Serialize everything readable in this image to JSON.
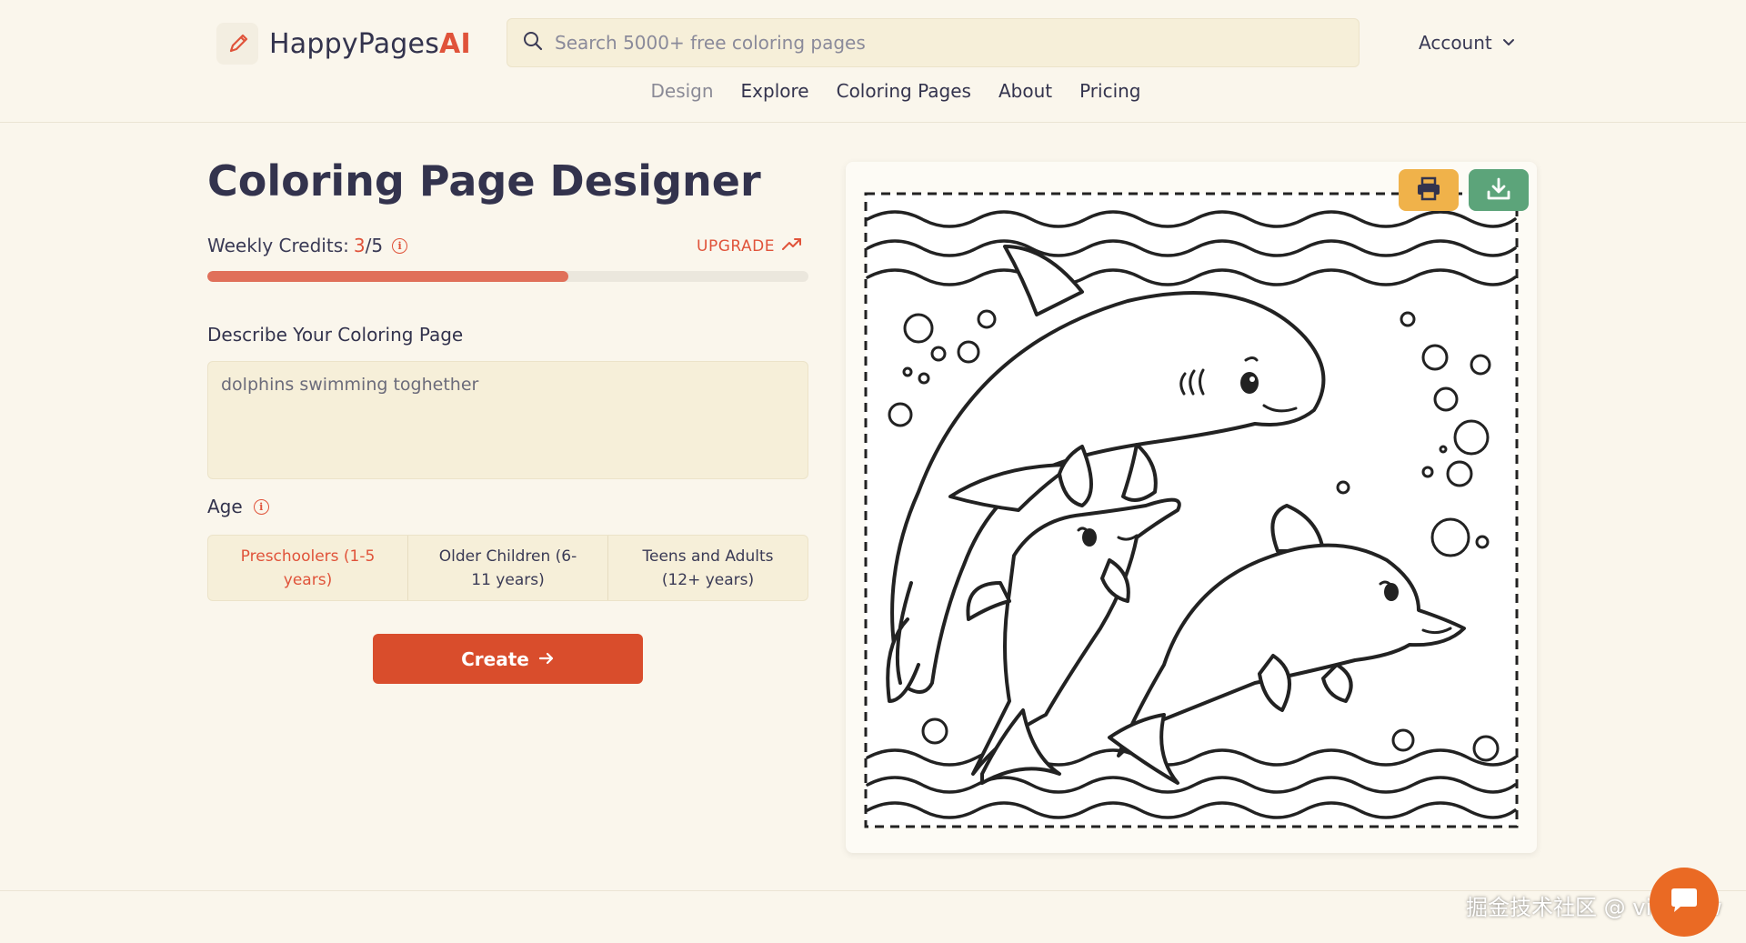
{
  "brand": {
    "name_prefix": "HappyPages",
    "name_suffix": "AI",
    "icon": "pencil-icon"
  },
  "search": {
    "placeholder": "Search 5000+ free coloring pages",
    "value": ""
  },
  "account": {
    "label": "Account"
  },
  "nav": {
    "items": [
      {
        "label": "Design",
        "active": true
      },
      {
        "label": "Explore"
      },
      {
        "label": "Coloring Pages"
      },
      {
        "label": "About"
      },
      {
        "label": "Pricing"
      }
    ]
  },
  "designer": {
    "title": "Coloring Page Designer",
    "credits_label": "Weekly Credits:",
    "credits_used": "3",
    "credits_total": "/5",
    "credits_fraction": 0.6,
    "upgrade_label": "UPGRADE",
    "describe_label": "Describe Your Coloring Page",
    "describe_value": "dolphins swimming toghether",
    "age_label": "Age",
    "age_options": [
      {
        "label": "Preschoolers (1-5 years)",
        "selected": true
      },
      {
        "label": "Older Children (6-11 years)"
      },
      {
        "label": "Teens and Adults (12+ years)"
      }
    ],
    "create_label": "Create"
  },
  "preview": {
    "print_icon": "printer-icon",
    "download_icon": "download-icon"
  },
  "watermark": "掘金技术社区 @ viggozw",
  "colors": {
    "accent": "#e0533a",
    "create": "#d94d2c",
    "print": "#f0b24a",
    "download": "#5ca47a",
    "background": "#faf6ec"
  }
}
